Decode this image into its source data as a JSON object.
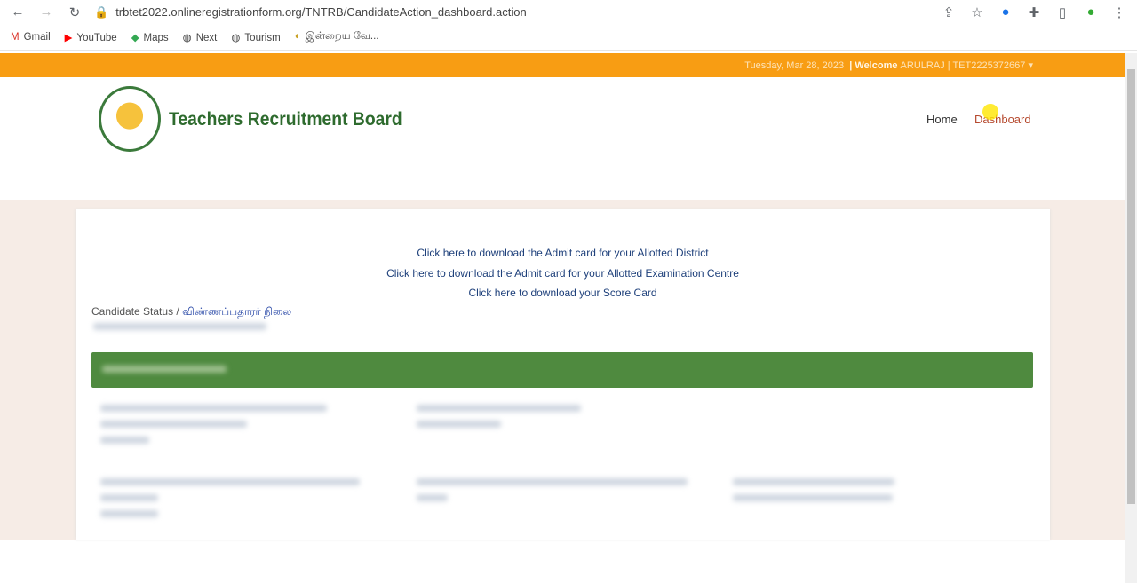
{
  "browser": {
    "url": "trbtet2022.onlineregistrationform.org/TNTRB/CandidateAction_dashboard.action",
    "bookmarks": [
      {
        "label": "Gmail",
        "icon": "gmail-icon"
      },
      {
        "label": "YouTube",
        "icon": "youtube-icon"
      },
      {
        "label": "Maps",
        "icon": "maps-icon"
      },
      {
        "label": "Next",
        "icon": "globe-icon"
      },
      {
        "label": "Tourism",
        "icon": "globe-icon"
      },
      {
        "label": "இன்றைய வே...",
        "icon": "site-icon"
      }
    ]
  },
  "topbar": {
    "date": "Tuesday, Mar 28, 2023",
    "welcome": "| Welcome",
    "user": "ARULRAJ | TET2225372667",
    "color": "#f89d13"
  },
  "header": {
    "title": "Teachers Recruitment Board",
    "nav": {
      "home": "Home",
      "dashboard": "Dashboard"
    }
  },
  "main": {
    "links": [
      "Click here to download the Admit card for your Allotted District",
      "Click here to download the Admit card for your Allotted Examination Centre",
      "Click here to download your Score Card"
    ],
    "status_label": "Candidate Status /",
    "status_tamil": "விண்ணப்பதாரர் நிலை"
  }
}
